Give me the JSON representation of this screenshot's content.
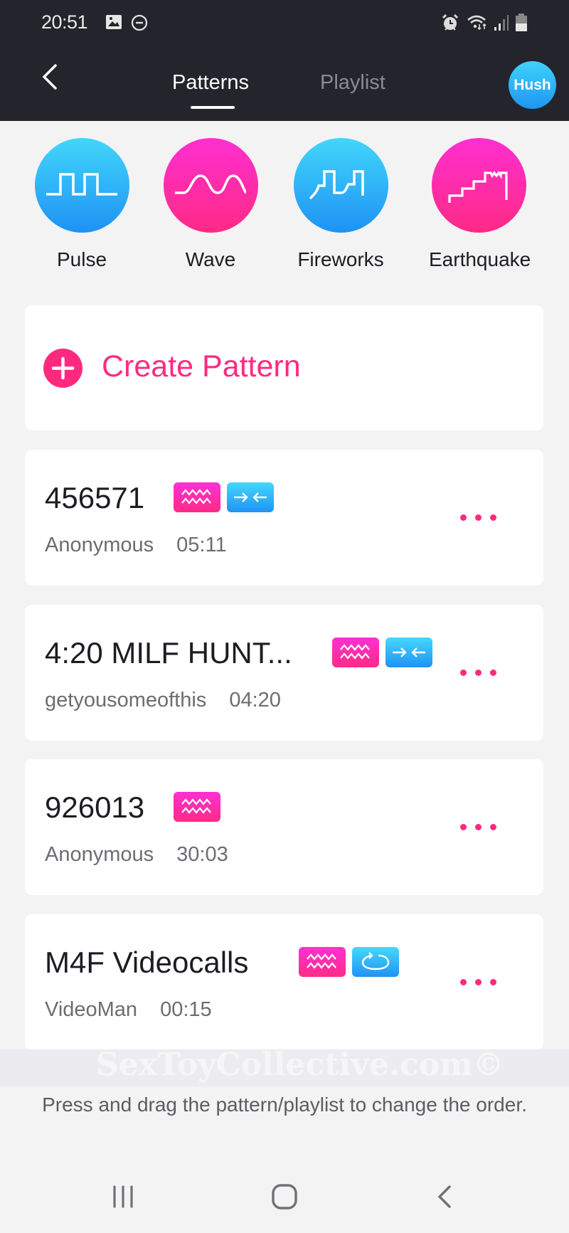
{
  "status_bar": {
    "time": "20:51",
    "left_icons": [
      "gallery-icon",
      "do-not-disturb-icon"
    ],
    "right_icons": [
      "alarm-icon",
      "wifi-icon",
      "signal-icon",
      "battery-icon"
    ]
  },
  "header": {
    "back_icon": "chevron-left-icon",
    "tabs": [
      {
        "label": "Patterns",
        "active": true
      },
      {
        "label": "Playlist",
        "active": false
      }
    ],
    "device_avatar": "Hush"
  },
  "presets": [
    {
      "label": "Pulse",
      "icon": "pulse-wave-icon",
      "color": "blue"
    },
    {
      "label": "Wave",
      "icon": "sine-wave-icon",
      "color": "pink"
    },
    {
      "label": "Fireworks",
      "icon": "fireworks-wave-icon",
      "color": "blue"
    },
    {
      "label": "Earthquake",
      "icon": "earthquake-wave-icon",
      "color": "pink"
    }
  ],
  "create_pattern": {
    "label": "Create Pattern",
    "icon": "plus-circle-icon"
  },
  "patterns": [
    {
      "name": "456571",
      "author": "Anonymous",
      "duration": "05:11",
      "badges": [
        "wave-badge",
        "arrows-in-badge"
      ]
    },
    {
      "name": "4:20 MILF HUNT...",
      "author": "getyousomeofthis",
      "duration": "04:20",
      "badges": [
        "wave-badge",
        "arrows-in-badge"
      ]
    },
    {
      "name": "926013",
      "author": "Anonymous",
      "duration": "30:03",
      "badges": [
        "wave-badge"
      ]
    },
    {
      "name": "M4F Videocalls",
      "author": "VideoMan",
      "duration": "00:15",
      "badges": [
        "wave-badge",
        "loop-badge"
      ]
    }
  ],
  "watermark": "SexToyCollective.com©",
  "hint": "Press and drag the pattern/playlist to change the order.",
  "nav_bar": [
    "recent-apps-icon",
    "home-icon",
    "back-icon"
  ],
  "colors": {
    "accent_pink": "#ff2a7f",
    "accent_blue": "#1f95f3",
    "header_bg": "#24242c",
    "page_bg": "#f3f3f4"
  }
}
